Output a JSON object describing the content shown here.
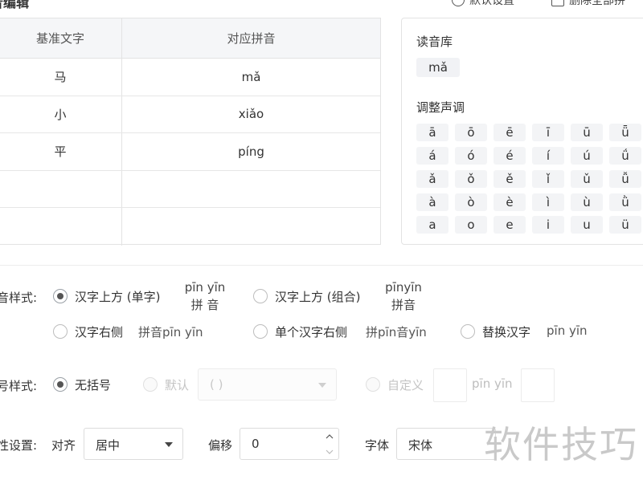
{
  "header": {
    "title": "音编辑",
    "action1": "默认设置",
    "action2": "删除全部拼"
  },
  "table": {
    "columns": [
      "基准文字",
      "对应拼音"
    ],
    "rows": [
      [
        "马",
        "mǎ"
      ],
      [
        "小",
        "xiǎo"
      ],
      [
        "平",
        "píng"
      ],
      [
        "",
        ""
      ],
      [
        "",
        ""
      ]
    ]
  },
  "right_panel": {
    "library_title": "读音库",
    "library_chip": "mǎ",
    "tone_title": "调整声调",
    "tones": [
      [
        "ā",
        "ō",
        "ē",
        "ī",
        "ū",
        "ǖ"
      ],
      [
        "á",
        "ó",
        "é",
        "í",
        "ú",
        "ǘ"
      ],
      [
        "ǎ",
        "ǒ",
        "ě",
        "ǐ",
        "ǔ",
        "ǚ"
      ],
      [
        "à",
        "ò",
        "è",
        "ì",
        "ù",
        "ǜ"
      ],
      [
        "a",
        "o",
        "e",
        "i",
        "u",
        "ü"
      ]
    ]
  },
  "pinyin_style": {
    "label": "音样式:",
    "opt_above_single": "汉字上方 (单字)",
    "sample_above_single_top": "pīn yīn",
    "sample_above_single_bottom": "拼  音",
    "opt_above_combined": "汉字上方 (组合)",
    "sample_above_combined_top": "pīnyīn",
    "sample_above_combined_bottom": "拼音",
    "opt_right": "汉字右侧",
    "sample_right": "拼音pīn yīn",
    "opt_single_right": "单个汉字右侧",
    "sample_single_right": "拼pīn音yīn",
    "opt_replace": "替换汉字",
    "sample_replace": "pīn yīn"
  },
  "bracket_style": {
    "label": "号样式:",
    "opt_none": "无括号",
    "opt_default": "默认",
    "default_select_value": "( )",
    "opt_custom": "自定义",
    "custom_sample": "pīn yīn"
  },
  "attr_settings": {
    "label": "性设置:",
    "align_label": "对齐",
    "align_value": "居中",
    "offset_label": "偏移",
    "offset_value": "0",
    "font_label": "字体",
    "font_value": "宋体"
  },
  "watermark": "软件技巧"
}
